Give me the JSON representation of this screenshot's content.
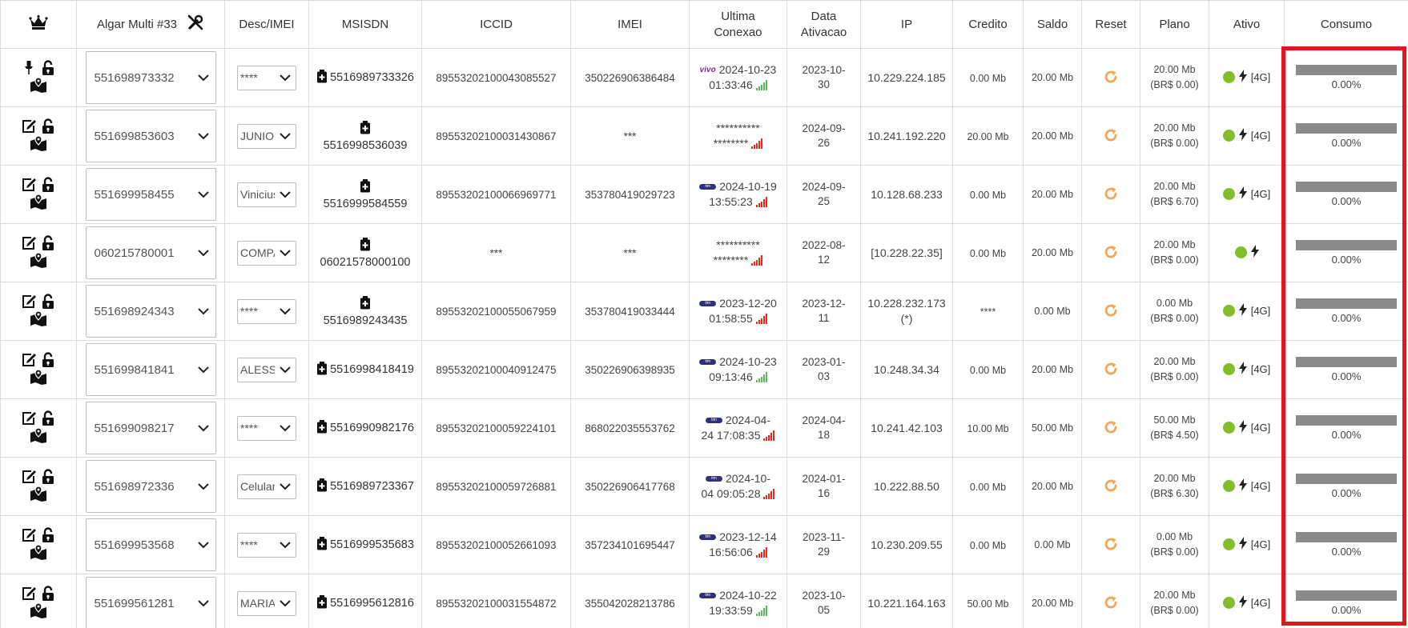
{
  "header": {
    "crown_icon": "crown-icon",
    "account": "Algar Multi #33",
    "tools_icon": "wrench-screwdriver-icon",
    "columns": [
      "Desc/IMEI",
      "MSISDN",
      "ICCID",
      "IMEI",
      "Ultima Conexao",
      "Data Ativacao",
      "IP",
      "Credito",
      "Saldo",
      "Reset",
      "Plano",
      "Ativo",
      "Consumo"
    ]
  },
  "colors": {
    "accent_reset": "#f2a65a",
    "active_dot": "#84bd2c",
    "highlight_border": "#e2161d",
    "consumo_bar": "#8a8a8a",
    "signal_red": "#e8291c",
    "signal_green": "#5cb85c"
  },
  "rows": [
    {
      "left_icon": "pin-icon",
      "number": "551698973332",
      "desc": "****",
      "msisdn": "5516989733326",
      "msisdn_stack": false,
      "iccid": "89553202100043085527",
      "imei": "350226906386484",
      "operator": "vivo",
      "conn_date": "2024-10-23",
      "conn_time": "01:33:46",
      "conn_split": false,
      "signal": "green",
      "activation": "2023-10-30",
      "ip": "10.229.224.185",
      "credit": "0.00 Mb",
      "balance": "20.00 Mb",
      "plan_mb": "20.00 Mb",
      "plan_brl": "(BR$ 0.00)",
      "net": "[4G]",
      "consumo": "0.00%"
    },
    {
      "left_icon": "edit-icon",
      "number": "551699853603",
      "desc": "JUNIOR",
      "msisdn": "5516998536039",
      "msisdn_stack": true,
      "iccid": "89553202100031430867",
      "imei": "***",
      "operator": "",
      "conn_date": "**********",
      "conn_time": "********",
      "conn_split": false,
      "signal": "red",
      "activation": "2024-09-26",
      "ip": "10.241.192.220",
      "credit": "20.00 Mb",
      "balance": "20.00 Mb",
      "plan_mb": "20.00 Mb",
      "plan_brl": "(BR$ 0.00)",
      "net": "[4G]",
      "consumo": "0.00%"
    },
    {
      "left_icon": "edit-icon",
      "number": "551699958455",
      "desc": "Vinicius",
      "msisdn": "5516999584559",
      "msisdn_stack": true,
      "iccid": "89553202100066969771",
      "imei": "353780419029723",
      "operator": "tim",
      "conn_date": "2024-10-19",
      "conn_time": "13:55:23",
      "conn_split": false,
      "signal": "red",
      "activation": "2024-09-25",
      "ip": "10.128.68.233",
      "credit": "0.00 Mb",
      "balance": "20.00 Mb",
      "plan_mb": "20.00 Mb",
      "plan_brl": "(BR$ 6.70)",
      "net": "[4G]",
      "consumo": "0.00%"
    },
    {
      "left_icon": "edit-icon",
      "number": "060215780001",
      "desc": "COMPANY",
      "msisdn": "06021578000100",
      "msisdn_stack": true,
      "iccid": "***",
      "imei": "***",
      "operator": "",
      "conn_date": "**********",
      "conn_time": "********",
      "conn_split": false,
      "signal": "red",
      "activation": "2022-08-12",
      "ip": "[10.228.22.35]",
      "credit": "0.00 Mb",
      "balance": "20.00 Mb",
      "plan_mb": "20.00 Mb",
      "plan_brl": "(BR$ 0.00)",
      "net": "",
      "consumo": "0.00%"
    },
    {
      "left_icon": "edit-icon",
      "number": "551698924343",
      "desc": "****",
      "msisdn": "5516989243435",
      "msisdn_stack": true,
      "iccid": "89553202100055067959",
      "imei": "353780419033444",
      "operator": "tim",
      "conn_date": "2023-12-20",
      "conn_time": "01:58:55",
      "conn_split": false,
      "signal": "red",
      "activation": "2023-12-11",
      "ip": "10.228.232.173",
      "ip_note": "(*)",
      "credit": "****",
      "balance": "0.00 Mb",
      "plan_mb": "0.00 Mb",
      "plan_brl": "(BR$ 0.00)",
      "net": "[4G]",
      "consumo": "0.00%"
    },
    {
      "left_icon": "edit-icon",
      "number": "551699841841",
      "desc": "ALESSANDRO",
      "msisdn": "5516998418419",
      "msisdn_stack": false,
      "iccid": "89553202100040912475",
      "imei": "350226906398935",
      "operator": "tim",
      "conn_date": "2024-10-23",
      "conn_time": "09:13:46",
      "conn_split": false,
      "signal": "green",
      "activation": "2023-01-03",
      "ip": "10.248.34.34",
      "credit": "0.00 Mb",
      "balance": "20.00 Mb",
      "plan_mb": "20.00 Mb",
      "plan_brl": "(BR$ 0.00)",
      "net": "[4G]",
      "consumo": "0.00%"
    },
    {
      "left_icon": "edit-icon",
      "number": "551699098217",
      "desc": "****",
      "msisdn": "5516990982176",
      "msisdn_stack": false,
      "iccid": "89553202100059224101",
      "imei": "868022035553762",
      "operator": "tim",
      "conn_date": "2024-04-",
      "conn_time": "24 17:08:35",
      "conn_split": true,
      "signal": "red",
      "activation": "2024-04-18",
      "ip": "10.241.42.103",
      "credit": "10.00 Mb",
      "balance": "50.00 Mb",
      "plan_mb": "50.00 Mb",
      "plan_brl": "(BR$ 4.50)",
      "net": "[4G]",
      "consumo": "0.00%"
    },
    {
      "left_icon": "edit-icon",
      "number": "551698972336",
      "desc": "Celular",
      "msisdn": "5516989723367",
      "msisdn_stack": false,
      "iccid": "89553202100059726881",
      "imei": "350226906417768",
      "operator": "tim",
      "conn_date": "2024-10-",
      "conn_time": "04 09:05:28",
      "conn_split": true,
      "signal": "red",
      "activation": "2024-01-16",
      "ip": "10.222.88.50",
      "credit": "0.00 Mb",
      "balance": "20.00 Mb",
      "plan_mb": "20.00 Mb",
      "plan_brl": "(BR$ 6.30)",
      "net": "[4G]",
      "consumo": "0.00%"
    },
    {
      "left_icon": "edit-icon",
      "number": "551699953568",
      "desc": "****",
      "msisdn": "5516999535683",
      "msisdn_stack": false,
      "iccid": "89553202100052661093",
      "imei": "357234101695447",
      "operator": "tim",
      "conn_date": "2023-12-14",
      "conn_time": "16:56:06",
      "conn_split": false,
      "signal": "red",
      "activation": "2023-11-29",
      "ip": "10.230.209.55",
      "credit": "0.00 Mb",
      "balance": "0.00 Mb",
      "plan_mb": "0.00 Mb",
      "plan_brl": "(BR$ 0.00)",
      "net": "[4G]",
      "consumo": "0.00%"
    },
    {
      "left_icon": "edit-icon",
      "number": "551699561281",
      "desc": "MARIA",
      "msisdn": "5516995612816",
      "msisdn_stack": false,
      "iccid": "89553202100031554872",
      "imei": "355042028213786",
      "operator": "tim",
      "conn_date": "2024-10-22",
      "conn_time": "19:33:59",
      "conn_split": false,
      "signal": "green",
      "activation": "2023-10-05",
      "ip": "10.221.164.163",
      "credit": "50.00 Mb",
      "balance": "20.00 Mb",
      "plan_mb": "20.00 Mb",
      "plan_brl": "(BR$ 0.00)",
      "net": "[4G]",
      "consumo": "0.00%"
    }
  ]
}
